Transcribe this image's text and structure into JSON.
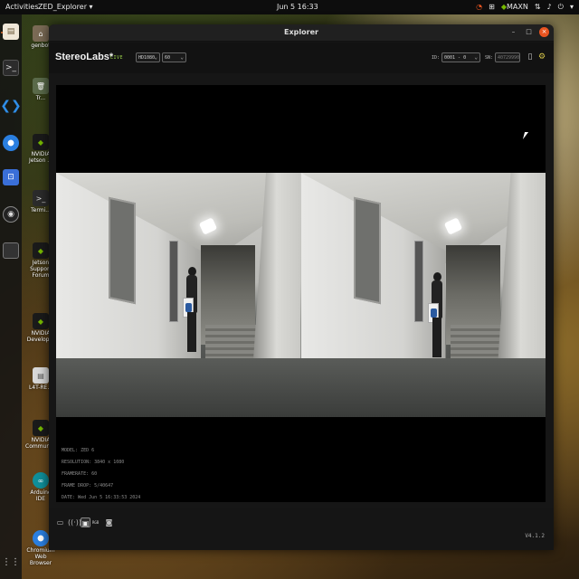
{
  "topbar": {
    "activities": "Activities",
    "app_menu": "ZED_Explorer ▾",
    "clock": "Jun 5  16:33",
    "tray_mode": "MAXN"
  },
  "desktop_icons": [
    {
      "label": "genbot",
      "icon": "home-folder-icon"
    },
    {
      "label": "Tr...",
      "icon": "trash-icon"
    },
    {
      "label": "NVIDIA Jetson ...",
      "icon": "nvidia-icon"
    },
    {
      "label": "Termi...",
      "icon": "terminal-icon"
    },
    {
      "label": "Jetson Support Forum",
      "icon": "nvidia-icon"
    },
    {
      "label": "NVIDIA Develop...",
      "icon": "nvidia-icon"
    },
    {
      "label": "L4T-RE...",
      "icon": "document-icon"
    },
    {
      "label": "NVIDIA Community...",
      "icon": "nvidia-icon"
    },
    {
      "label": "Arduino IDE",
      "icon": "arduino-icon"
    },
    {
      "label": "Chromium Web Browser",
      "icon": "chromium-icon"
    }
  ],
  "window": {
    "title": "Explorer",
    "min": "–",
    "max": "□",
    "close": "×"
  },
  "toolbar": {
    "brand": "StereoLabs*",
    "live": "LIVE",
    "resolution": "HD1080",
    "fps": "60",
    "id_label": "ID:",
    "id_value": "0001 - 0",
    "sn_label": "SN:",
    "sn_value": "40729990"
  },
  "info": {
    "model": "MODEL: ZED 6",
    "resolution": "RESOLUTION: 3840 x 1080",
    "framerate": "FRAMERATE: 60",
    "frame_drop": "FRAME DROP: 5/40647",
    "date": "DATE: Wed Jun 5 16:33:53 2024"
  },
  "bottombar": {
    "tag": "RGB",
    "version": "V4.1.2"
  },
  "colors": {
    "accent_green": "#76b900",
    "close_orange": "#e95420",
    "window_bg": "#161616"
  }
}
